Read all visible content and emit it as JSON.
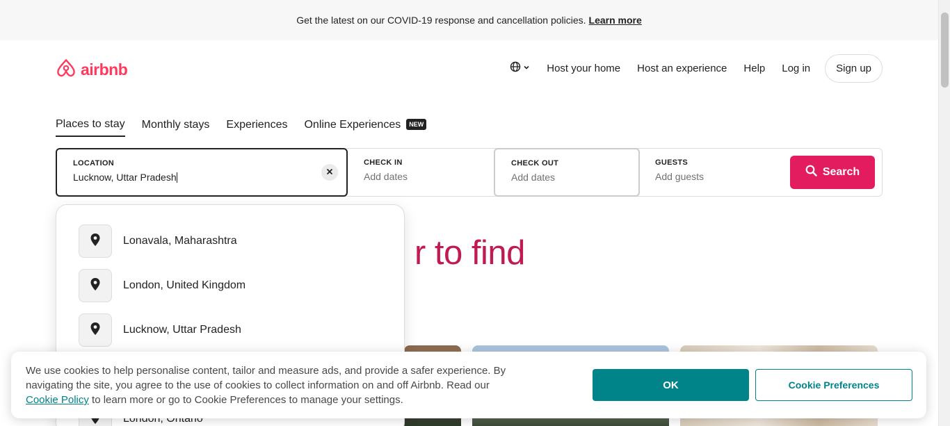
{
  "banner": {
    "text": "Get the latest on our COVID-19 response and cancellation policies.",
    "link": "Learn more"
  },
  "header": {
    "logo_text": "airbnb",
    "nav": [
      "Host your home",
      "Host an experience",
      "Help",
      "Log in"
    ],
    "signup": "Sign up"
  },
  "tabs": [
    "Places to stay",
    "Monthly stays",
    "Experiences",
    "Online Experiences"
  ],
  "tab_badge": "NEW",
  "search": {
    "location_label": "LOCATION",
    "location_value": "Lucknow, Uttar Pradesh",
    "checkin_label": "CHECK IN",
    "checkin_placeholder": "Add dates",
    "checkout_label": "CHECK OUT",
    "checkout_placeholder": "Add dates",
    "guests_label": "GUESTS",
    "guests_placeholder": "Add guests",
    "button": "Search"
  },
  "suggestions": [
    "Lonavala, Maharashtra",
    "London, United Kingdom",
    "Lucknow, Uttar Pradesh",
    "London, Ontario"
  ],
  "hero_fragment": "r to find",
  "cookie": {
    "text": "We use cookies to help personalise content, tailor and measure ads, and provide a safer experience. By navigating the site, you agree to the use of cookies to collect information on and off Airbnb. Read our",
    "policy_link": "Cookie Policy",
    "text_after": "to learn more or go to Cookie Preferences to manage your settings.",
    "ok": "OK",
    "preferences": "Cookie Preferences"
  },
  "colors": {
    "brand": "#ff385c",
    "search": "#e31c5f",
    "cookie_accent": "#008489"
  }
}
